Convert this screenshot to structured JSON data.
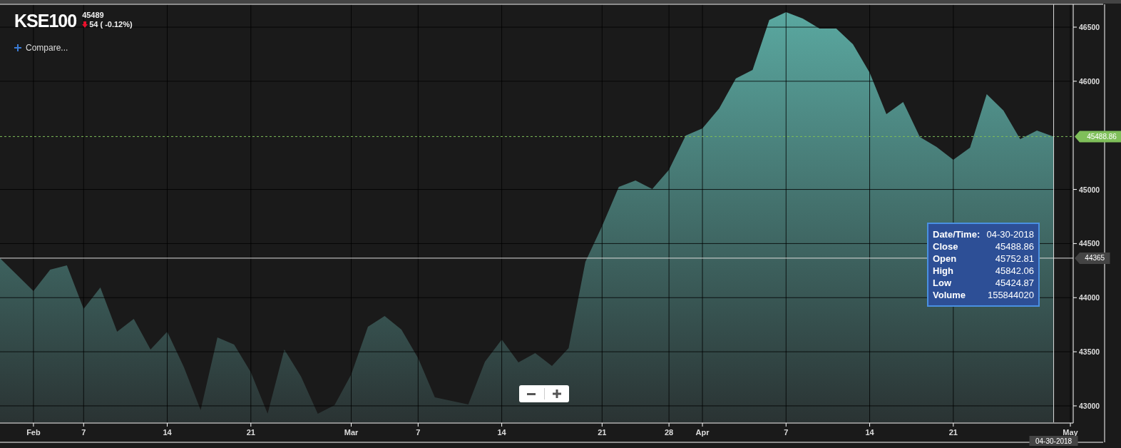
{
  "header": {
    "symbol": "KSE100",
    "price": "45489",
    "change": "54 ( -0.12%)",
    "negative": true
  },
  "compare": {
    "label": "Compare..."
  },
  "chart": {
    "chart_data": {
      "type": "area",
      "categories": [
        null,
        null,
        "Feb",
        null,
        null,
        "7",
        null,
        null,
        null,
        null,
        "14",
        null,
        null,
        null,
        null,
        "21",
        null,
        null,
        null,
        null,
        null,
        "Mar",
        null,
        null,
        null,
        "7",
        null,
        null,
        null,
        null,
        "14",
        null,
        null,
        null,
        null,
        null,
        "21",
        null,
        null,
        null,
        "28",
        null,
        "Apr",
        null,
        null,
        null,
        null,
        "7",
        null,
        null,
        null,
        null,
        "14",
        null,
        null,
        null,
        null,
        "21",
        null,
        null,
        null,
        null,
        null,
        null,
        "May"
      ],
      "series": [
        {
          "color": "#5aa8a0",
          "values": [
            44365,
            44213,
            44061,
            44259,
            44299,
            43897,
            44094,
            43686,
            43804,
            43521,
            43686,
            43356,
            42961,
            43633,
            43567,
            43310,
            42928,
            43521,
            43270,
            42928,
            43007,
            43290,
            43732,
            43831,
            43705,
            43442,
            43079,
            43046,
            43013,
            43409,
            43613,
            43402,
            43488,
            43369,
            43534,
            44332,
            44661,
            45024,
            45083,
            45004,
            45182,
            45498,
            45564,
            45749,
            46025,
            46105,
            46566,
            46638,
            46579,
            46487,
            46487,
            46342,
            46078,
            45696,
            45808,
            45485,
            45393,
            45274,
            45386,
            45880,
            45729,
            45465,
            45544,
            45489,
            null
          ]
        }
      ],
      "ylim": [
        42848,
        46698
      ],
      "yticks": [
        43000,
        43500,
        44000,
        44500,
        45000,
        46000,
        46500
      ],
      "grid": true,
      "ref_lines": [
        {
          "axis": "y",
          "value": 45488.86,
          "color": "#7fbf5a",
          "label": "45488.86"
        },
        {
          "axis": "y",
          "value": 44365,
          "color": "#dddddd",
          "label": "44365"
        }
      ]
    }
  },
  "crosshair": {
    "date_label": "04-30-2018"
  },
  "tooltip": {
    "rows": [
      {
        "label": "Date/Time:",
        "value": "04-30-2018"
      },
      {
        "label": "Close",
        "value": "45488.86"
      },
      {
        "label": "Open",
        "value": "45752.81"
      },
      {
        "label": "High",
        "value": "45842.06"
      },
      {
        "label": "Low",
        "value": "45424.87"
      },
      {
        "label": "Volume",
        "value": "155844020"
      }
    ]
  }
}
